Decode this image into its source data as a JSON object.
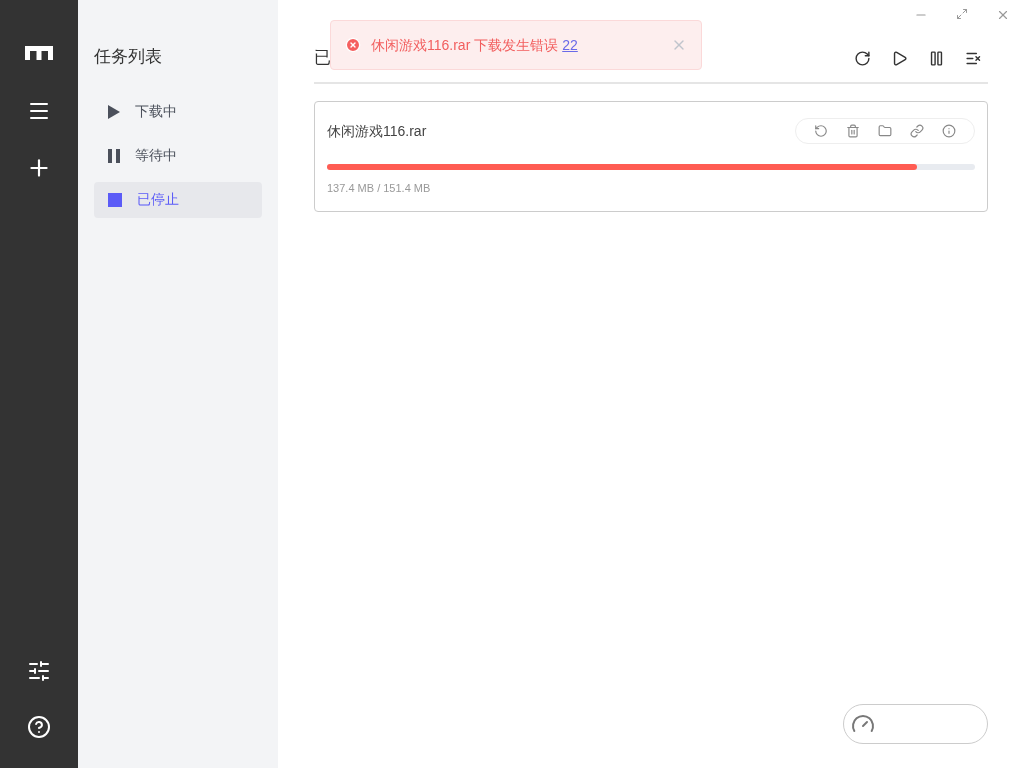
{
  "sidebar": {
    "title": "任务列表",
    "items": [
      {
        "label": "下载中",
        "kind": "active",
        "selected": false
      },
      {
        "label": "等待中",
        "kind": "waiting",
        "selected": false
      },
      {
        "label": "已停止",
        "kind": "stopped",
        "selected": true
      }
    ]
  },
  "header": {
    "title": "已"
  },
  "toast": {
    "message": "休闲游戏116.rar 下载发生错误",
    "link": "22"
  },
  "tasks": [
    {
      "name": "休闲游戏116.rar",
      "level": 0.91,
      "size": "137.4 MB / 151.4 MB"
    }
  ]
}
